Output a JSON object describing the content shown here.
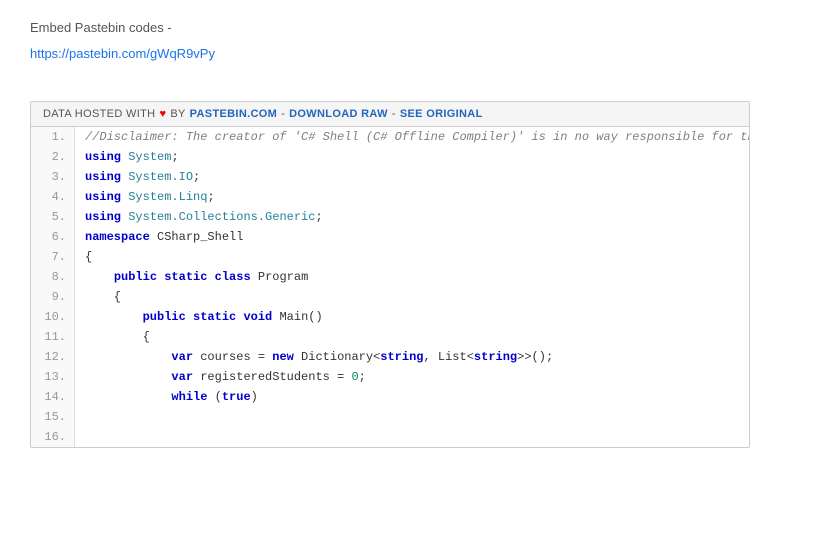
{
  "page": {
    "embed_title": "Embed Pastebin codes -",
    "embed_link": "https://pastebin.com/gWqR9vPy",
    "header": {
      "prefix": "DATA HOSTED WITH",
      "heart": "♥",
      "by": "BY",
      "pastebin": "PASTEBIN.COM",
      "sep1": "-",
      "download": "DOWNLOAD RAW",
      "sep2": "-",
      "original": "SEE ORIGINAL"
    },
    "lines": [
      {
        "num": 1,
        "tokens": [
          {
            "t": "comment",
            "v": "//Disclaimer: The creator of 'C# Shell (C# Offline Compiler)' is in no way responsible for the code posted by any user."
          }
        ]
      },
      {
        "num": 2,
        "tokens": [
          {
            "t": "keyword",
            "v": "using"
          },
          {
            "t": "plain",
            "v": " "
          },
          {
            "t": "type-name",
            "v": "System"
          },
          {
            "t": "plain",
            "v": ";"
          }
        ]
      },
      {
        "num": 3,
        "tokens": [
          {
            "t": "keyword",
            "v": "using"
          },
          {
            "t": "plain",
            "v": " "
          },
          {
            "t": "type-name",
            "v": "System.IO"
          },
          {
            "t": "plain",
            "v": ";"
          }
        ]
      },
      {
        "num": 4,
        "tokens": [
          {
            "t": "keyword",
            "v": "using"
          },
          {
            "t": "plain",
            "v": " "
          },
          {
            "t": "type-name",
            "v": "System.Linq"
          },
          {
            "t": "plain",
            "v": ";"
          }
        ]
      },
      {
        "num": 5,
        "tokens": [
          {
            "t": "keyword",
            "v": "using"
          },
          {
            "t": "plain",
            "v": " "
          },
          {
            "t": "type-name",
            "v": "System.Collections.Generic"
          },
          {
            "t": "plain",
            "v": ";"
          }
        ]
      },
      {
        "num": 6,
        "tokens": [
          {
            "t": "plain",
            "v": ""
          }
        ]
      },
      {
        "num": 7,
        "tokens": [
          {
            "t": "keyword",
            "v": "namespace"
          },
          {
            "t": "plain",
            "v": " CSharp_Shell"
          }
        ]
      },
      {
        "num": 8,
        "tokens": [
          {
            "t": "plain",
            "v": "{"
          }
        ]
      },
      {
        "num": 9,
        "tokens": [
          {
            "t": "plain",
            "v": ""
          }
        ]
      },
      {
        "num": 10,
        "tokens": [
          {
            "t": "plain",
            "v": "    "
          },
          {
            "t": "keyword",
            "v": "public"
          },
          {
            "t": "plain",
            "v": " "
          },
          {
            "t": "keyword",
            "v": "static"
          },
          {
            "t": "plain",
            "v": " "
          },
          {
            "t": "keyword",
            "v": "class"
          },
          {
            "t": "plain",
            "v": " Program"
          }
        ]
      },
      {
        "num": 11,
        "tokens": [
          {
            "t": "plain",
            "v": "    {"
          }
        ]
      },
      {
        "num": 12,
        "tokens": [
          {
            "t": "plain",
            "v": "        "
          },
          {
            "t": "keyword",
            "v": "public"
          },
          {
            "t": "plain",
            "v": " "
          },
          {
            "t": "keyword",
            "v": "static"
          },
          {
            "t": "plain",
            "v": " "
          },
          {
            "t": "keyword",
            "v": "void"
          },
          {
            "t": "plain",
            "v": " Main()"
          }
        ]
      },
      {
        "num": 13,
        "tokens": [
          {
            "t": "plain",
            "v": "        {"
          }
        ]
      },
      {
        "num": 14,
        "tokens": [
          {
            "t": "plain",
            "v": "            "
          },
          {
            "t": "keyword",
            "v": "var"
          },
          {
            "t": "plain",
            "v": " courses = "
          },
          {
            "t": "keyword",
            "v": "new"
          },
          {
            "t": "plain",
            "v": " Dictionary<"
          },
          {
            "t": "keyword",
            "v": "string"
          },
          {
            "t": "plain",
            "v": ", List<"
          },
          {
            "t": "keyword",
            "v": "string"
          },
          {
            "t": "plain",
            "v": ">>();"
          }
        ]
      },
      {
        "num": 15,
        "tokens": [
          {
            "t": "plain",
            "v": "            "
          },
          {
            "t": "keyword",
            "v": "var"
          },
          {
            "t": "plain",
            "v": " registeredStudents = "
          },
          {
            "t": "number",
            "v": "0"
          },
          {
            "t": "plain",
            "v": ";"
          }
        ]
      },
      {
        "num": 16,
        "tokens": [
          {
            "t": "plain",
            "v": "            "
          },
          {
            "t": "keyword",
            "v": "while"
          },
          {
            "t": "plain",
            "v": " ("
          },
          {
            "t": "keyword",
            "v": "true"
          },
          {
            "t": "plain",
            "v": ")"
          }
        ]
      }
    ]
  }
}
